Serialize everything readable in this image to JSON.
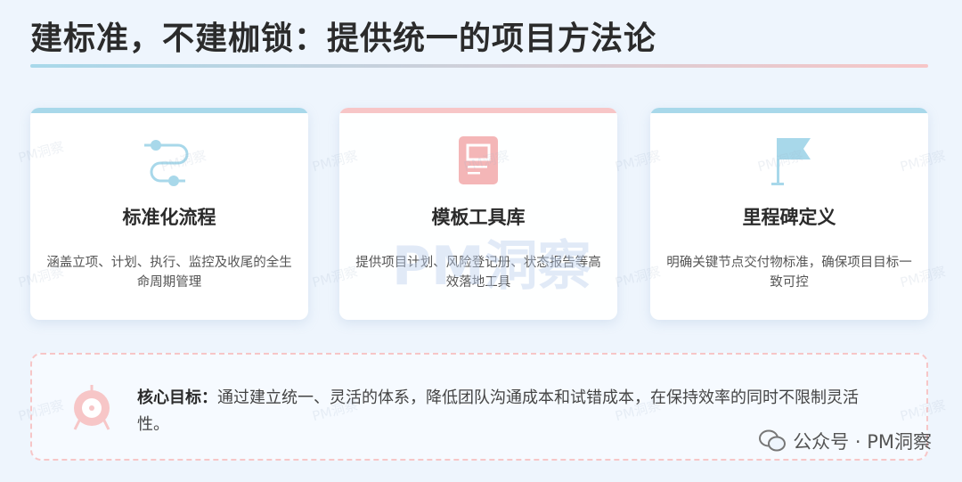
{
  "header": {
    "title": "建标准，不建枷锁：提供统一的项目方法论"
  },
  "cards": [
    {
      "title": "标准化流程",
      "desc": "涵盖立项、计划、执行、监控及收尾的全生命周期管理",
      "icon": "process-path-icon",
      "accent": "#a8d8ea"
    },
    {
      "title": "模板工具库",
      "desc": "提供项目计划、风险登记册、状态报告等高效落地工具",
      "icon": "document-template-icon",
      "accent": "#f7c6c7"
    },
    {
      "title": "里程碑定义",
      "desc": "明确关键节点交付物标准，确保项目目标一致可控",
      "icon": "flag-icon",
      "accent": "#a8d8ea"
    }
  ],
  "goal": {
    "label": "核心目标：",
    "text": "通过建立统一、灵活的体系，降低团队沟通成本和试错成本，在保持效率的同时不限制灵活性。"
  },
  "watermark": "PM洞察",
  "footer": {
    "text": "公众号 · PM洞察"
  }
}
